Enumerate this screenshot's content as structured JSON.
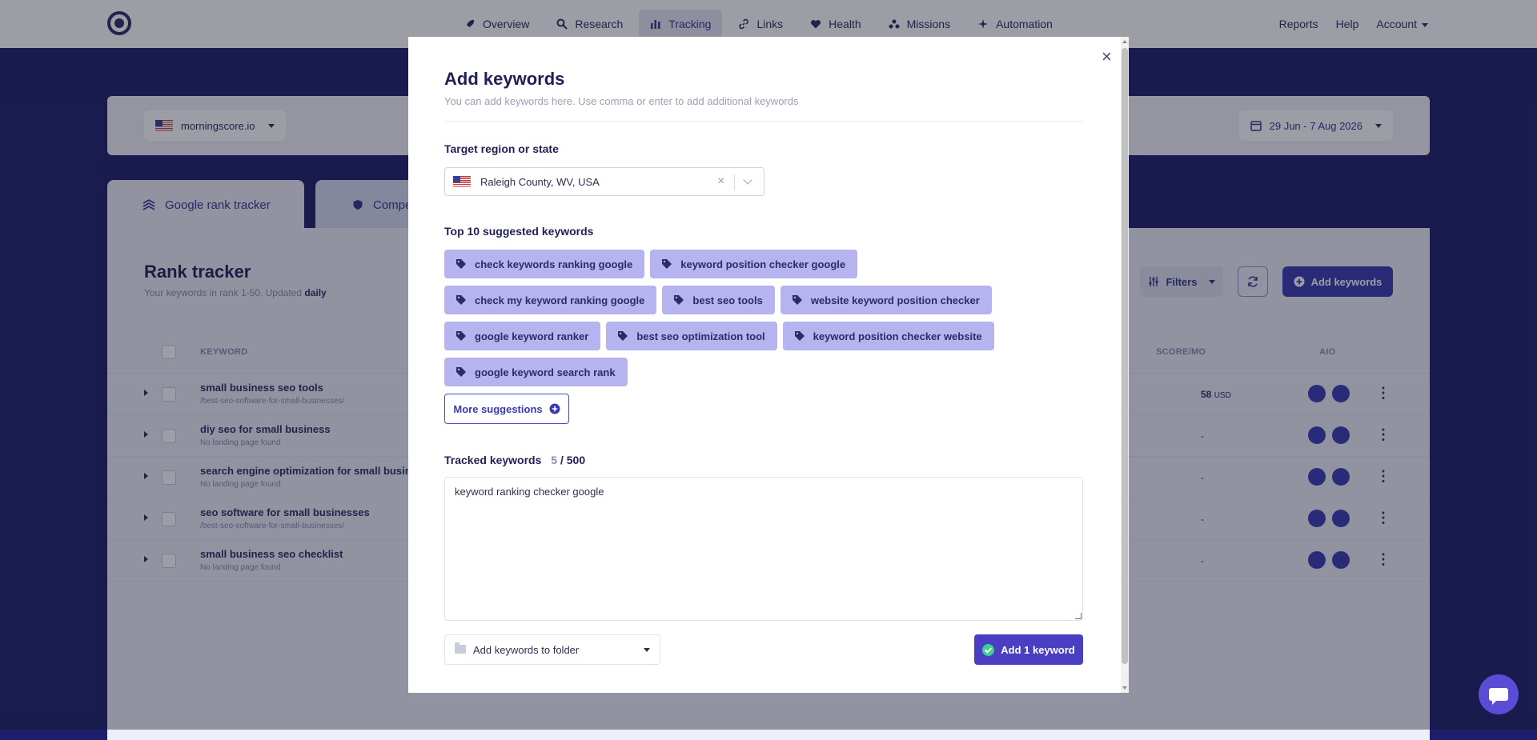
{
  "nav": {
    "items": [
      {
        "label": "Overview",
        "icon": "overview-icon"
      },
      {
        "label": "Research",
        "icon": "search-icon"
      },
      {
        "label": "Tracking",
        "icon": "bar-chart-icon"
      },
      {
        "label": "Links",
        "icon": "link-icon"
      },
      {
        "label": "Health",
        "icon": "heart-icon"
      },
      {
        "label": "Missions",
        "icon": "missions-icon"
      },
      {
        "label": "Automation",
        "icon": "sparkle-icon"
      }
    ],
    "active": "Tracking",
    "right": {
      "reports": "Reports",
      "help": "Help",
      "account": "Account"
    }
  },
  "filterbar": {
    "site": "morningscore.io",
    "date_range": "29 Jun - 7 Aug 2026"
  },
  "tabs": {
    "google": "Google rank tracker",
    "competitors": "Compe"
  },
  "panel": {
    "title": "Rank tracker",
    "subtitle_prefix": "Your keywords in rank 1-50. Updated",
    "subtitle_bold": "daily",
    "filters_label": "Filters",
    "add_keywords_label": "Add keywords",
    "columns": {
      "keyword": "KEYWORD",
      "score": "SCORE/MO",
      "aio": "AIO"
    },
    "rows": [
      {
        "keyword": "small business seo tools",
        "url": "/best-seo-software-for-small-businesses/",
        "score": "58",
        "score_unit": "USD"
      },
      {
        "keyword": "diy seo for small business",
        "url": "No landing page found",
        "score": "-",
        "score_unit": ""
      },
      {
        "keyword": "search engine optimization for small business",
        "url": "No landing page found",
        "score": "-",
        "score_unit": ""
      },
      {
        "keyword": "seo software for small businesses",
        "url": "/best-seo-software-for-small-businesses/",
        "score": "-",
        "score_unit": ""
      },
      {
        "keyword": "small business seo checklist",
        "url": "No landing page found",
        "score": "-",
        "score_unit": ""
      }
    ]
  },
  "modal": {
    "close": "×",
    "title": "Add keywords",
    "subtitle": "You can add keywords here. Use comma or enter to add additional keywords",
    "region_label": "Target region or state",
    "region_value": "Raleigh County, WV, USA",
    "region_clear": "×",
    "suggested_label": "Top 10 suggested keywords",
    "suggestions": [
      "check keywords ranking google",
      "keyword position checker google",
      "check my keyword ranking google",
      "best seo tools",
      "website keyword position checker",
      "google keyword ranker",
      "best seo optimization tool",
      "keyword position checker website",
      "google keyword search rank"
    ],
    "more_suggestions": "More suggestions",
    "tracked_label": "Tracked keywords",
    "tracked_count": "5",
    "tracked_total": "/ 500",
    "textarea_value": "keyword ranking checker google",
    "folder_placeholder": "Add keywords to folder",
    "add_button": "Add 1 keyword"
  },
  "colors": {
    "accent": "#4a3ec4",
    "chip_bg": "#b5b3f0",
    "page_bg": "#1e1f6b",
    "success": "#3fd18b"
  }
}
